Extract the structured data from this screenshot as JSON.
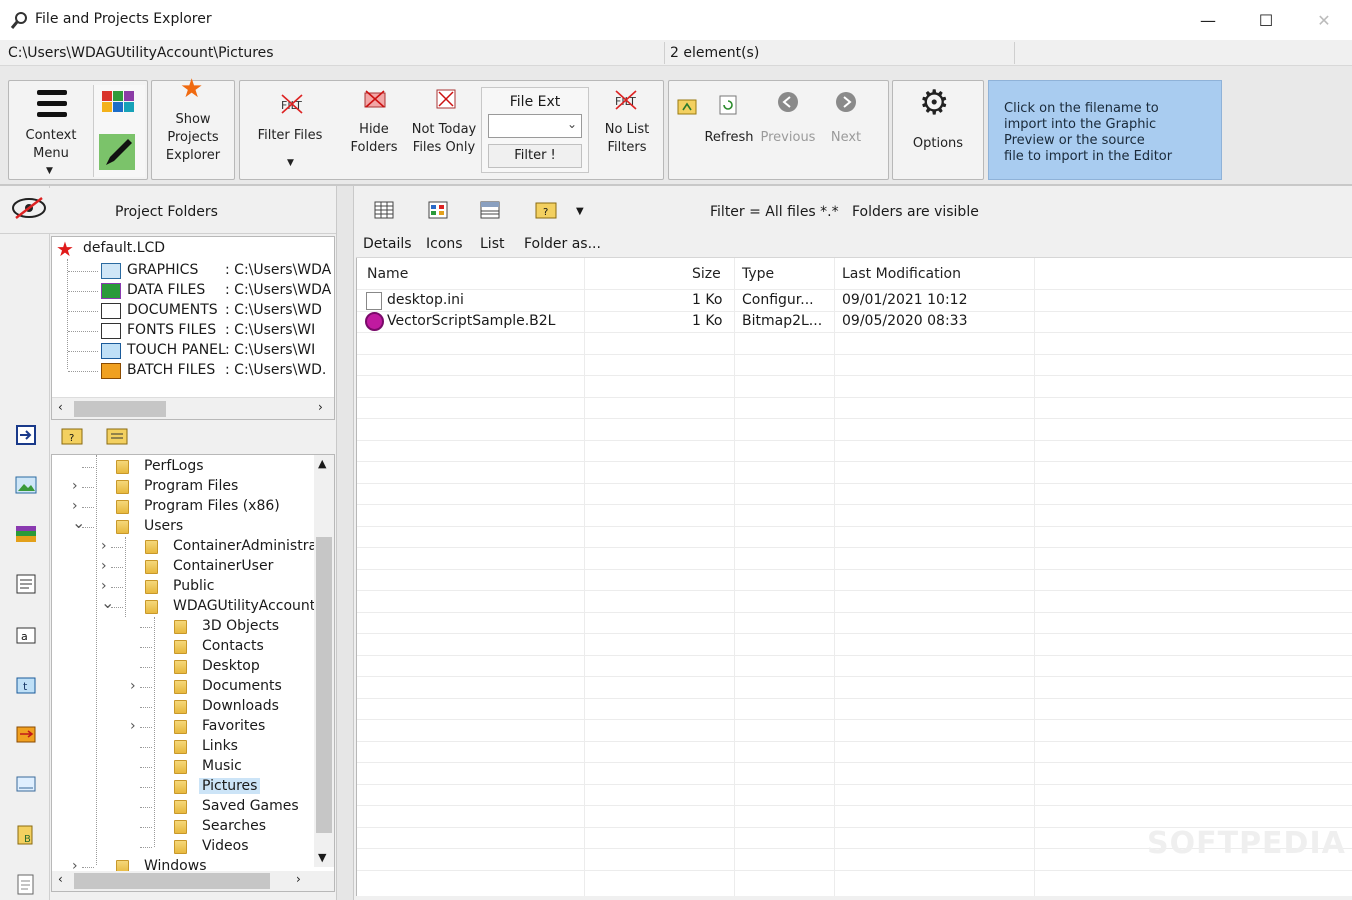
{
  "window": {
    "title": "File and Projects Explorer",
    "controls": [
      "—",
      "☐",
      "✕"
    ]
  },
  "pathbar": {
    "path": "C:\\Users\\WDAGUtilityAccount\\Pictures",
    "count": "2 element(s)"
  },
  "toolbar": {
    "context_menu": [
      "Context",
      "Menu"
    ],
    "show_projects": [
      "Show",
      "Projects",
      "Explorer"
    ],
    "filter_files": "Filter Files",
    "hide_folders": [
      "Hide",
      "Folders"
    ],
    "not_today": [
      "Not Today",
      "Files Only"
    ],
    "file_ext": "File Ext",
    "filter_btn": "Filter !",
    "no_list": [
      "No List",
      "Filters"
    ],
    "refresh": "Refresh",
    "previous": "Previous",
    "next": "Next",
    "options": "Options",
    "info": [
      "Click on the filename to",
      "import into the Graphic",
      "Preview or the source",
      "file to import in the Editor"
    ],
    "info_color": "#a9ccf0"
  },
  "left": {
    "title": "Project Folders",
    "project": "default.LCD",
    "items": [
      {
        "name": "GRAPHICS",
        "path": ": C:\\Users\\WDA"
      },
      {
        "name": "DATA FILES",
        "path": ": C:\\Users\\WDA"
      },
      {
        "name": "DOCUMENTS",
        "path": ": C:\\Users\\WD"
      },
      {
        "name": "FONTS FILES",
        "path": ": C:\\Users\\WI"
      },
      {
        "name": "TOUCH PANEL",
        "path": ": C:\\Users\\WI"
      },
      {
        "name": "BATCH FILES",
        "path": ": C:\\Users\\WD."
      }
    ],
    "folders": [
      {
        "label": "PerfLogs",
        "level": 1,
        "expander": ""
      },
      {
        "label": "Program Files",
        "level": 1,
        "expander": "›"
      },
      {
        "label": "Program Files (x86)",
        "level": 1,
        "expander": "›"
      },
      {
        "label": "Users",
        "level": 1,
        "expander": "⌄"
      },
      {
        "label": "ContainerAdministra",
        "level": 2,
        "expander": "›"
      },
      {
        "label": "ContainerUser",
        "level": 2,
        "expander": "›"
      },
      {
        "label": "Public",
        "level": 2,
        "expander": "›"
      },
      {
        "label": "WDAGUtilityAccount",
        "level": 2,
        "expander": "⌄"
      },
      {
        "label": "3D Objects",
        "level": 3,
        "expander": ""
      },
      {
        "label": "Contacts",
        "level": 3,
        "expander": ""
      },
      {
        "label": "Desktop",
        "level": 3,
        "expander": ""
      },
      {
        "label": "Documents",
        "level": 3,
        "expander": "›"
      },
      {
        "label": "Downloads",
        "level": 3,
        "expander": ""
      },
      {
        "label": "Favorites",
        "level": 3,
        "expander": "›"
      },
      {
        "label": "Links",
        "level": 3,
        "expander": ""
      },
      {
        "label": "Music",
        "level": 3,
        "expander": ""
      },
      {
        "label": "Pictures",
        "level": 3,
        "expander": "",
        "selected": true
      },
      {
        "label": "Saved Games",
        "level": 3,
        "expander": ""
      },
      {
        "label": "Searches",
        "level": 3,
        "expander": ""
      },
      {
        "label": "Videos",
        "level": 3,
        "expander": ""
      },
      {
        "label": "Windows",
        "level": 1,
        "expander": "›"
      }
    ]
  },
  "right": {
    "status": "Filter = All files *.*   Folders are visible",
    "tabs": [
      "Details",
      "Icons",
      "List",
      "Folder as..."
    ],
    "columns": [
      "Name",
      "Size",
      "Type",
      "Last Modification"
    ],
    "rows": [
      {
        "name": "desktop.ini",
        "size": "1 Ko",
        "type": "Configur...",
        "modified": "09/01/2021 10:12",
        "icon": "ini-file-icon"
      },
      {
        "name": "VectorScriptSample.B2L",
        "size": "1 Ko",
        "type": "Bitmap2L...",
        "modified": "09/05/2020 08:33",
        "icon": "b2l-file-icon"
      }
    ]
  },
  "watermark": "SOFTPEDIA"
}
